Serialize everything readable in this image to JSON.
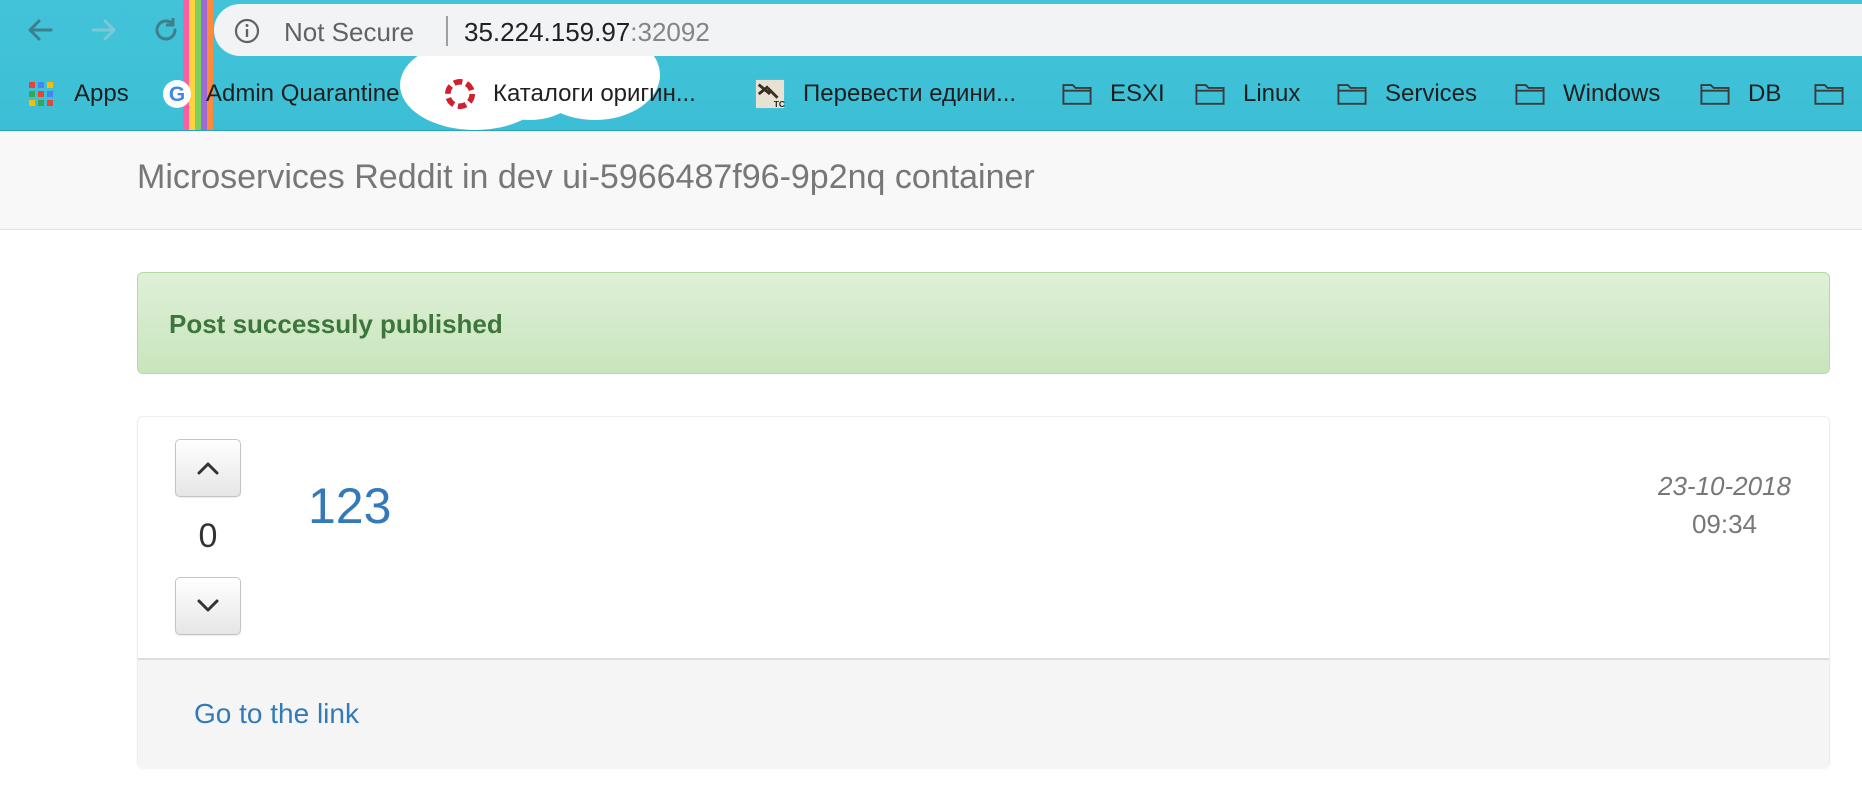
{
  "browser": {
    "security_label": "Not Secure",
    "url_host": "35.224.159.97",
    "url_port": ":32092"
  },
  "bookmarks": [
    {
      "label": "Apps",
      "icon": "apps-grid-icon"
    },
    {
      "label": "Admin Quarantine",
      "icon": "google-icon"
    },
    {
      "label": "Каталоги оригин...",
      "icon": "lifebuoy-icon"
    },
    {
      "label": "Перевести едини...",
      "icon": "translate-tc-icon"
    },
    {
      "label": "ESXI",
      "icon": "folder-icon"
    },
    {
      "label": "Linux",
      "icon": "folder-icon"
    },
    {
      "label": "Services",
      "icon": "folder-icon"
    },
    {
      "label": "Windows",
      "icon": "folder-icon"
    },
    {
      "label": "DB",
      "icon": "folder-icon"
    },
    {
      "label": "",
      "icon": "folder-icon"
    }
  ],
  "navbar": {
    "brand": "Microservices Reddit in dev ui-5966487f96-9p2nq container"
  },
  "alert": {
    "message": "Post successuly published",
    "color": "#3c763d"
  },
  "post": {
    "votes": "0",
    "title": "123",
    "date": "23-10-2018",
    "time": "09:34",
    "link_label": "Go to the link",
    "link_color": "#337ab7"
  }
}
